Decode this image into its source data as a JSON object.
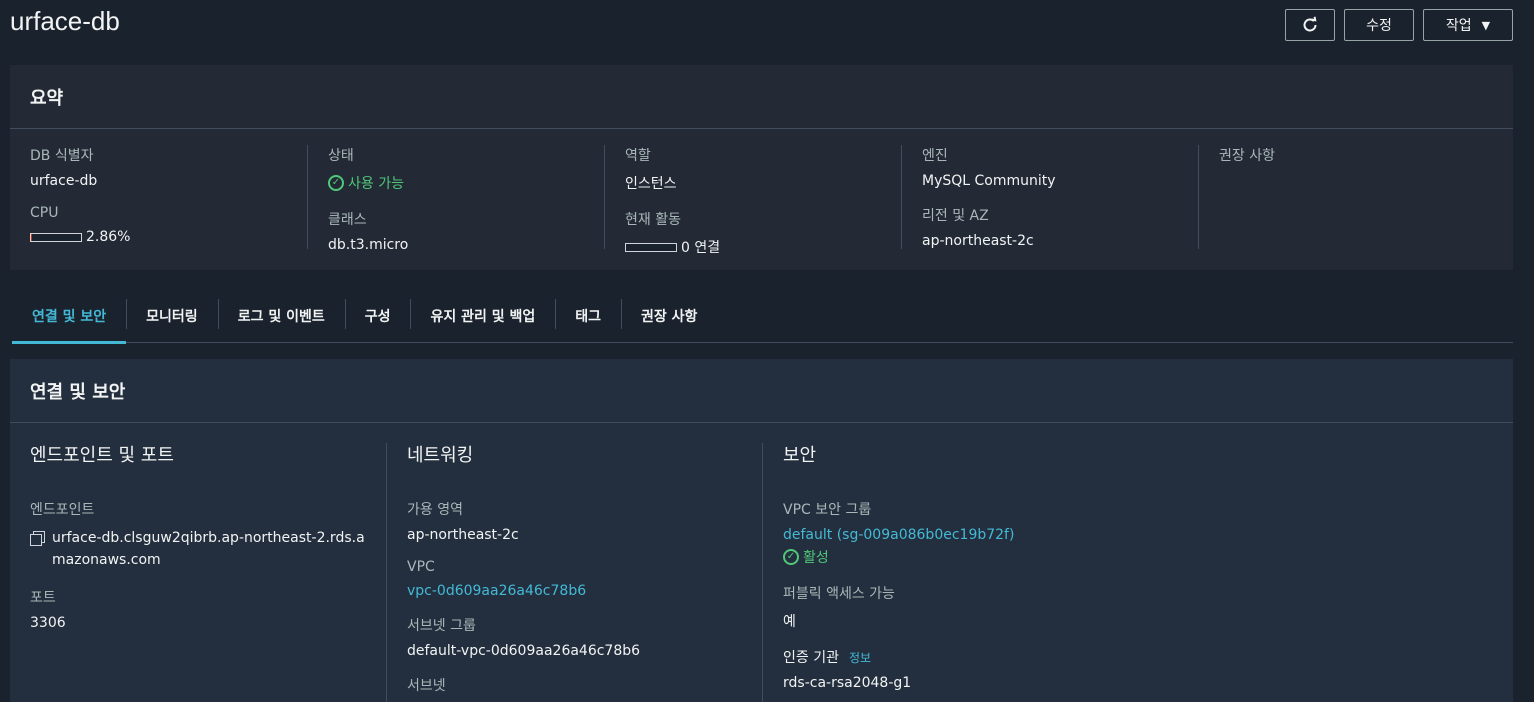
{
  "header": {
    "title": "urface-db",
    "edit_label": "수정",
    "actions_label": "작업",
    "refresh_icon": "refresh-icon"
  },
  "summary": {
    "title": "요약",
    "db_id_label": "DB 식별자",
    "db_id": "urface-db",
    "cpu_label": "CPU",
    "cpu_value": "2.86%",
    "cpu_fraction": 0.0286,
    "status_label": "상태",
    "status": "사용 가능",
    "class_label": "클래스",
    "class": "db.t3.micro",
    "role_label": "역할",
    "role": "인스턴스",
    "activity_label": "현재 활동",
    "activity": "0 연결",
    "activity_fraction": 0,
    "engine_label": "엔진",
    "engine": "MySQL Community",
    "region_label": "리전 및 AZ",
    "region": "ap-northeast-2c",
    "recommend_label": "권장 사항"
  },
  "tabs": [
    {
      "label": "연결 및 보안"
    },
    {
      "label": "모니터링"
    },
    {
      "label": "로그 및 이벤트"
    },
    {
      "label": "구성"
    },
    {
      "label": "유지 관리 및 백업"
    },
    {
      "label": "태그"
    },
    {
      "label": "권장 사항"
    }
  ],
  "connection": {
    "title": "연결 및 보안",
    "endpoint_section": "엔드포인트 및 포트",
    "endpoint_label": "엔드포인트",
    "endpoint": "urface-db.clsguw2qibrb.ap-northeast-2.rds.amazonaws.com",
    "port_label": "포트",
    "port": "3306",
    "network_section": "네트워킹",
    "az_label": "가용 영역",
    "az": "ap-northeast-2c",
    "vpc_label": "VPC",
    "vpc": "vpc-0d609aa26a46c78b6",
    "subnet_group_label": "서브넷 그룹",
    "subnet_group": "default-vpc-0d609aa26a46c78b6",
    "subnet_label": "서브넷",
    "security_section": "보안",
    "sg_label": "VPC 보안 그룹",
    "sg": "default (sg-009a086b0ec19b72f)",
    "sg_status": "활성",
    "public_label": "퍼블릭 액세스 가능",
    "public": "예",
    "ca_label": "인증 기관",
    "ca_info": "정보",
    "ca": "rds-ca-rsa2048-g1"
  },
  "colors": {
    "background": "#1a222d",
    "panel": "#232f3e",
    "accent_link": "#44b9d6",
    "status_ok": "#50c878"
  }
}
